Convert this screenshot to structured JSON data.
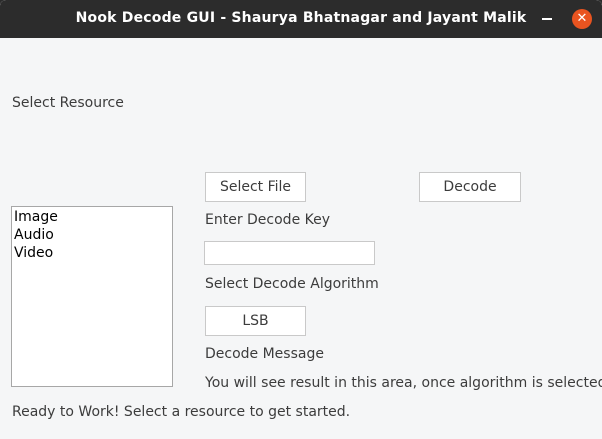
{
  "window": {
    "title": "Nook Decode GUI - Shaurya Bhatnagar and Jayant Malik",
    "minimize_icon": "minimize-icon",
    "close_icon": "close-icon",
    "close_glyph": "✕",
    "close_color": "#e95420"
  },
  "resource": {
    "label": "Select Resource",
    "items": [
      "Image",
      "Audio",
      "Video"
    ]
  },
  "actions": {
    "select_file_label": "Select File",
    "decode_label": "Decode"
  },
  "key": {
    "label": "Enter Decode Key",
    "value": ""
  },
  "algorithm": {
    "label": "Select Decode Algorithm",
    "button_label": "LSB"
  },
  "message": {
    "label": "Decode Message",
    "text": "You will see result in this area, once algorithm is selected."
  },
  "status": {
    "text": "Ready to Work! Select a resource to get started."
  }
}
